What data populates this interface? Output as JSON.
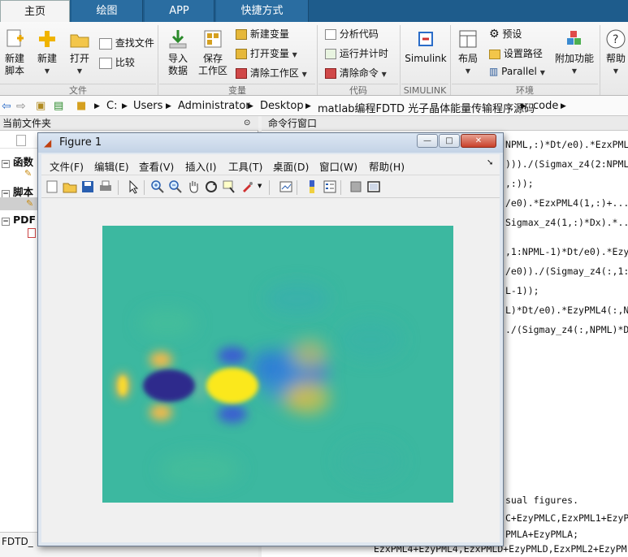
{
  "tabs": [
    {
      "label": "主页",
      "active": true
    },
    {
      "label": "绘图",
      "active": false
    },
    {
      "label": "APP",
      "active": false
    },
    {
      "label": "快捷方式",
      "active": false
    }
  ],
  "ribbon": {
    "file_group": {
      "new_script": "新建\n脚本",
      "new_script_l1": "新建",
      "new_script_l2": "脚本",
      "new": "新建",
      "open": "打开",
      "find_files": "查找文件",
      "compare": "比较",
      "label": "文件"
    },
    "variable_group": {
      "import_l1": "导入",
      "import_l2": "数据",
      "save_l1": "保存",
      "save_l2": "工作区",
      "new_variable": "新建变量",
      "open_variable": "打开变量",
      "clear_workspace": "清除工作区",
      "label": "变量"
    },
    "code_group": {
      "analyze": "分析代码",
      "run_time": "运行并计时",
      "clear_commands": "清除命令",
      "label": "代码"
    },
    "simulink_group": {
      "simulink": "Simulink",
      "label": "SIMULINK"
    },
    "env_group": {
      "layout": "布局",
      "preferences": "预设",
      "set_path": "设置路径",
      "parallel": "Parallel",
      "addons": "附加功能",
      "label": "环境"
    },
    "help": "帮助"
  },
  "address": {
    "crumbs": [
      "C:",
      "Users",
      "Administrator",
      "Desktop",
      "matlab编程FDTD 光子晶体能量传输程序源码",
      "code"
    ]
  },
  "left_panel": {
    "title": "当前文件夹",
    "sections": [
      {
        "label": "函数"
      },
      {
        "label": "脚本"
      },
      {
        "label": "PDF"
      }
    ],
    "status": "FDTD_"
  },
  "command_window": {
    "title": "命令行窗口",
    "lines": [
      "NPML,:)*Dt/e0).*EzxPML4",
      ")))./(Sigmax_z4(2:NPML,",
      ",:));",
      "/e0).*EzxPML4(1,:)+...",
      "Sigmax_z4(1,:)*Dx).*...",
      ",1:NPML-1)*Dt/e0).*Ezy",
      "/e0))./(Sigmay_z4(:,1:N",
      "L-1));",
      "L)*Dt/e0).*EzyPML4(:,N",
      "./(Sigmay_z4(:,NPML)*D",
      "sual figures.",
      "C+EzyPMLC,EzxPML1+EzyPM",
      "PMLA+EzyPMLA;",
      "EzxPML4+EzyPML4,EzxPMLD+EzyPMLD,EzxPML2+EzyPM"
    ]
  },
  "figure": {
    "title": "Figure 1",
    "menu": [
      "文件(F)",
      "编辑(E)",
      "查看(V)",
      "插入(I)",
      "工具(T)",
      "桌面(D)",
      "窗口(W)",
      "帮助(H)"
    ],
    "colors": {
      "background": "#3cb8a0",
      "deep_blue": "#2e2a8c",
      "yellow": "#fbe81e",
      "orange": "#f5b94a",
      "mid_blue": "#2f7ad8"
    }
  }
}
